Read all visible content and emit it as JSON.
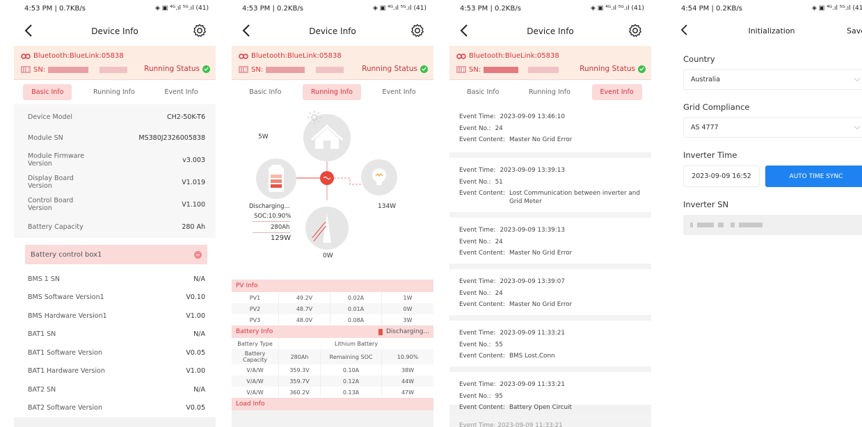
{
  "colors": {
    "accent": "#d8323b",
    "tab_active_bg": "#fbdada",
    "device_bar_bg": "#fdece2",
    "status_ok": "#3cbf4c",
    "button_blue": "#1e83f0"
  },
  "screen1": {
    "status": {
      "time": "4:53 PM | 0.7KB/s",
      "right": "◈ ▣ ⁴ᴳ.ıl ⁵ᴳ.ıl (41)"
    },
    "title": "Device Info",
    "bluetooth": "Bluetooth:BlueLink:05838",
    "sn_label": "SN:",
    "running_status": "Running Status",
    "tabs": [
      "Basic Info",
      "Running Info",
      "Event Info"
    ],
    "basic": [
      {
        "label": "Device Model",
        "value": "CH2-50K-T6"
      },
      {
        "label": "Module SN",
        "value": "MS380J2326005838"
      },
      {
        "label": "Module Firmware Version",
        "value": "v3.003"
      },
      {
        "label": "Display Board Version",
        "value": "V1.019"
      },
      {
        "label": "Control Board Version",
        "value": "V1.100"
      },
      {
        "label": "Battery Capacity",
        "value": "280 Ah"
      }
    ],
    "battery_box_title": "Battery control box1",
    "battery_rows": [
      {
        "label": "BMS 1 SN",
        "value": "N/A"
      },
      {
        "label": "BMS Software Version1",
        "value": "V0.10"
      },
      {
        "label": "BMS Hardware Version1",
        "value": "V1.00"
      },
      {
        "label": "BAT1 SN",
        "value": "N/A"
      },
      {
        "label": "BAT1 Software Version",
        "value": "V0.05"
      },
      {
        "label": "BAT1 Hardware Version",
        "value": "V1.00"
      },
      {
        "label": "BAT2 SN",
        "value": "N/A"
      },
      {
        "label": "BAT2 Software Version",
        "value": "V0.05"
      }
    ]
  },
  "screen2": {
    "status": {
      "time": "4:53 PM | 0.2KB/s",
      "right": "◈ ▣ ⁴ᴳ.ıl ⁵ᴳ.ıl (41)"
    },
    "title": "Device Info",
    "bluetooth": "Bluetooth:BlueLink:05838",
    "sn_label": "SN:",
    "running_status": "Running Status",
    "tabs": [
      "Basic Info",
      "Running Info",
      "Event Info"
    ],
    "flow": {
      "home_power": "5W",
      "battery_state": "Discharging...",
      "soc": "SOC:10.90%",
      "capacity": "280Ah",
      "battery_power": "129W",
      "load_power": "134W",
      "grid_power": "0W"
    },
    "pv_title": "PV Info",
    "pv_rows": [
      [
        "PV1",
        "49.2V",
        "0.02A",
        "1W"
      ],
      [
        "PV2",
        "48.7V",
        "0.01A",
        "0W"
      ],
      [
        "PV3",
        "48.0V",
        "0.08A",
        "3W"
      ]
    ],
    "battery_title": "Battery Info",
    "battery_status": "Discharging...",
    "battery_type_label": "Battery Type",
    "battery_type": "Lithium Battery",
    "battery_capacity_label": "Battery Capacity",
    "battery_capacity": "280Ah",
    "remaining_soc_label": "Remaining SOC",
    "remaining_soc": "10.90%",
    "vaw_rows": [
      [
        "V/A/W",
        "359.3V",
        "0.10A",
        "38W"
      ],
      [
        "V/A/W",
        "359.7V",
        "0.12A",
        "44W"
      ],
      [
        "V/A/W",
        "360.2V",
        "0.13A",
        "47W"
      ]
    ],
    "load_title": "Load Info"
  },
  "screen3": {
    "status": {
      "time": "4:53 PM | 0.2KB/s",
      "right": "◈ ▣ ⁴ᴳ.ıl ⁵ᴳ.ıl (41)"
    },
    "title": "Device Info",
    "bluetooth": "Bluetooth:BlueLink:05838",
    "sn_label": "SN:",
    "running_status": "Running Status",
    "tabs": [
      "Basic Info",
      "Running Info",
      "Event Info"
    ],
    "labels": {
      "time": "Event Time:",
      "no": "Event No.:",
      "content": "Event Content:"
    },
    "events": [
      {
        "time": "2023-09-09 13:46:10",
        "no": "24",
        "content": "Master No Grid Error"
      },
      {
        "time": "2023-09-09 13:39:13",
        "no": "51",
        "content": "Lost Communication between inverter and Grid Meter"
      },
      {
        "time": "2023-09-09 13:39:13",
        "no": "24",
        "content": "Master No Grid Error"
      },
      {
        "time": "2023-09-09 13:39:07",
        "no": "24",
        "content": "Master No Grid Error"
      },
      {
        "time": "2023-09-09 11:33:21",
        "no": "55",
        "content": "BMS Lost.Conn"
      },
      {
        "time": "2023-09-09 11:33:21",
        "no": "95",
        "content": "Battery Open Circuit"
      }
    ],
    "partial": "Event Time: 2023-09-09 11:33:21"
  },
  "screen4": {
    "status": {
      "time": "4:54 PM | 0.2KB/s",
      "right": "◈ ▣ ⁴ᴳ.ıl ⁵ᴳ.ıl (41)"
    },
    "title": "Initialization",
    "save": "Save",
    "country_label": "Country",
    "country_value": "Australia",
    "grid_label": "Grid Compliance",
    "grid_value": "AS 4777",
    "time_label": "Inverter Time",
    "time_value": "2023-09-09 16:52",
    "sync_button": "AUTO TIME SYNC",
    "sn_label": "Inverter SN"
  }
}
